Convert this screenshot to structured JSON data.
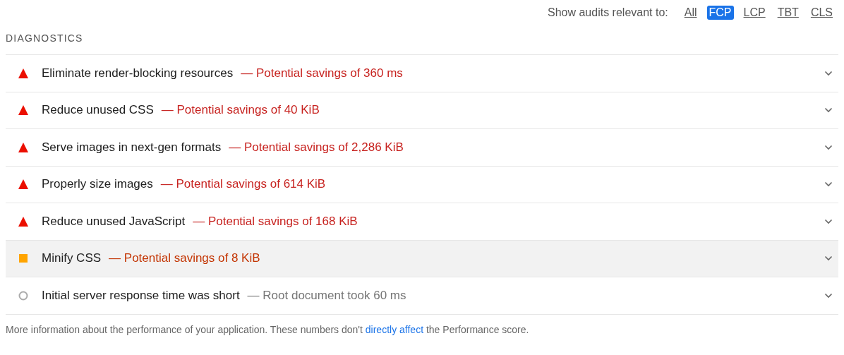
{
  "filter": {
    "label": "Show audits relevant to:",
    "options": [
      {
        "label": "All",
        "selected": false
      },
      {
        "label": "FCP",
        "selected": true
      },
      {
        "label": "LCP",
        "selected": false
      },
      {
        "label": "TBT",
        "selected": false
      },
      {
        "label": "CLS",
        "selected": false
      }
    ]
  },
  "section_title": "DIAGNOSTICS",
  "audits": [
    {
      "kind": "fail",
      "title": "Eliminate render-blocking resources",
      "detail": "— Potential savings of 360 ms",
      "highlighted": false
    },
    {
      "kind": "fail",
      "title": "Reduce unused CSS",
      "detail": "— Potential savings of 40 KiB",
      "highlighted": false
    },
    {
      "kind": "fail",
      "title": "Serve images in next-gen formats",
      "detail": "— Potential savings of 2,286 KiB",
      "highlighted": false
    },
    {
      "kind": "fail",
      "title": "Properly size images",
      "detail": "— Potential savings of 614 KiB",
      "highlighted": false
    },
    {
      "kind": "fail",
      "title": "Reduce unused JavaScript",
      "detail": "— Potential savings of 168 KiB",
      "highlighted": false
    },
    {
      "kind": "average",
      "title": "Minify CSS",
      "detail": "— Potential savings of 8 KiB",
      "highlighted": true
    },
    {
      "kind": "pass",
      "title": "Initial server response time was short",
      "detail": "— Root document took 60 ms",
      "highlighted": false
    }
  ],
  "footer": {
    "before": "More information about the performance of your application. These numbers don't ",
    "link": "directly affect",
    "after": " the Performance score."
  }
}
